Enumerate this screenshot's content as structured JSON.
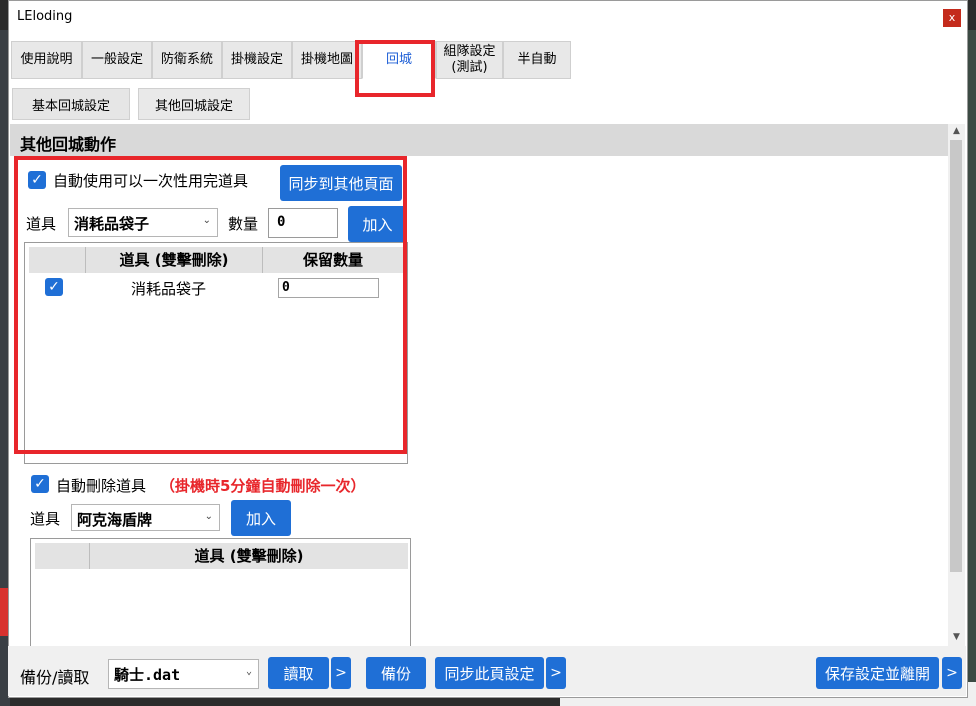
{
  "window": {
    "title": "LEloding",
    "close_label": "x"
  },
  "tabs": [
    {
      "label": "使用說明"
    },
    {
      "label": "一般設定"
    },
    {
      "label": "防衛系統"
    },
    {
      "label": "掛機設定"
    },
    {
      "label": "掛機地圖"
    },
    {
      "label": "回城",
      "active": true
    },
    {
      "label": "組隊設定\n(測試)"
    },
    {
      "label": "半自動"
    }
  ],
  "subtabs": [
    {
      "label": "基本回城設定"
    },
    {
      "label": "其他回城設定",
      "active": true
    }
  ],
  "section": {
    "title": "其他回城動作",
    "auto_use": {
      "checkbox_label": "自動使用可以一次性用完道具",
      "checked": true,
      "sync_button": "同步到其他頁面",
      "item_label": "道具",
      "item_value": "消耗品袋子",
      "qty_label": "數量",
      "qty_value": "0",
      "add_button": "加入",
      "grid": {
        "col_item": "道具 (雙擊刪除)",
        "col_keep": "保留數量",
        "rows": [
          {
            "checked": true,
            "item": "消耗品袋子",
            "keep": "0"
          }
        ]
      }
    },
    "auto_delete": {
      "checkbox_label": "自動刪除道具",
      "checked": true,
      "note": "（掛機時5分鐘自動刪除一次）",
      "item_label": "道具",
      "item_value": "阿克海盾牌",
      "add_button": "加入",
      "grid": {
        "col_item": "道具 (雙擊刪除)"
      }
    }
  },
  "footer": {
    "backup_label": "備份/讀取",
    "file_value": "騎士.dat",
    "read_button": "讀取",
    "more": ">",
    "backup_button": "備份",
    "sync_button": "同步此頁設定",
    "save_exit_button": "保存設定並離開"
  },
  "colors": {
    "accent": "#1f6fd6",
    "highlight_box": "#e8262b",
    "active_tab_text": "#1e5fd6"
  }
}
